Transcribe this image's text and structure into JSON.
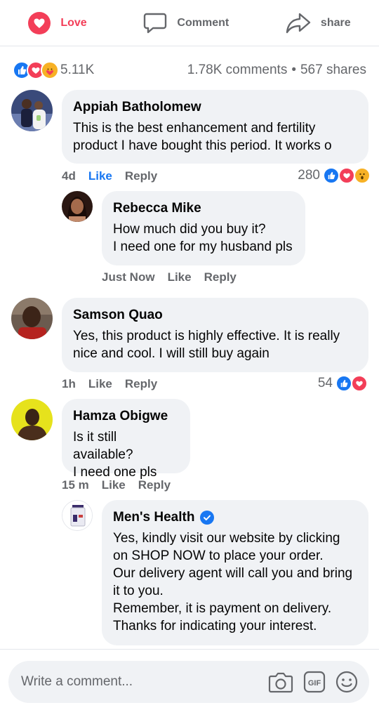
{
  "actions": {
    "love": "Love",
    "comment": "Comment",
    "share": "share"
  },
  "summary": {
    "reaction_count": "5.11K",
    "comments": "1.78K comments",
    "separator": "•",
    "shares": "567 shares"
  },
  "comments": [
    {
      "author": "Appiah Batholomew",
      "text": "This is the best enhancement and fertility\nproduct I have bought this period. It works o",
      "time": "4d",
      "like": "Like",
      "reply": "Reply",
      "reaction_count": "280"
    },
    {
      "author": "Rebecca Mike",
      "text": "How much did you buy it?\nI need one for my husband pls",
      "time": "Just Now",
      "like": "Like",
      "reply": "Reply"
    },
    {
      "author": "Samson Quao",
      "text": "Yes, this product is highly effective. It is really\nnice and cool. I will still buy again",
      "time": "1h",
      "like": "Like",
      "reply": "Reply",
      "reaction_count": "54"
    },
    {
      "author": "Hamza Obigwe",
      "text": "Is it still available?\nI need one pls",
      "time": "15 m",
      "like": "Like",
      "reply": "Reply"
    },
    {
      "author": "Men's Health",
      "text": "Yes, kindly visit our website by clicking\non SHOP NOW to place your order.\nOur delivery agent will call you and bring\nit to you.\nRemember, it is payment on delivery.\nThanks for indicating your interest.",
      "verified": true
    }
  ],
  "composer": {
    "placeholder": "Write a comment...",
    "gif": "GIF"
  },
  "colors": {
    "brand_blue": "#1877f2",
    "love_red": "#f33e58",
    "bubble_bg": "#f0f2f5",
    "muted_text": "#65676b"
  }
}
